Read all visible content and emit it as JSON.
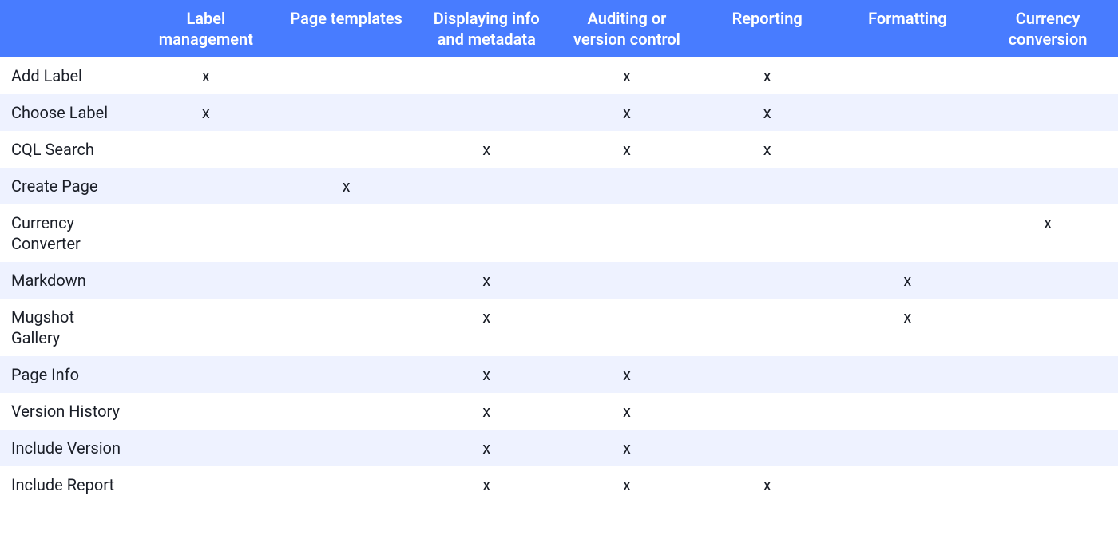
{
  "mark": "x",
  "columns": [
    "",
    "Label management",
    "Page templates",
    "Displaying info and metadata",
    "Auditing or version control",
    "Reporting",
    "Formatting",
    "Currency conversion"
  ],
  "rows": [
    {
      "label": "Add Label",
      "marks": [
        true,
        false,
        false,
        true,
        true,
        false,
        false
      ]
    },
    {
      "label": "Choose Label",
      "marks": [
        true,
        false,
        false,
        true,
        true,
        false,
        false
      ]
    },
    {
      "label": "CQL Search",
      "marks": [
        false,
        false,
        true,
        true,
        true,
        false,
        false
      ]
    },
    {
      "label": "Create Page",
      "marks": [
        false,
        true,
        false,
        false,
        false,
        false,
        false
      ]
    },
    {
      "label": "Currency Converter",
      "marks": [
        false,
        false,
        false,
        false,
        false,
        false,
        true
      ]
    },
    {
      "label": "Markdown",
      "marks": [
        false,
        false,
        true,
        false,
        false,
        true,
        false
      ]
    },
    {
      "label": "Mugshot Gallery",
      "marks": [
        false,
        false,
        true,
        false,
        false,
        true,
        false
      ]
    },
    {
      "label": "Page Info",
      "marks": [
        false,
        false,
        true,
        true,
        false,
        false,
        false
      ]
    },
    {
      "label": "Version History",
      "marks": [
        false,
        false,
        true,
        true,
        false,
        false,
        false
      ]
    },
    {
      "label": "Include Version",
      "marks": [
        false,
        false,
        true,
        true,
        false,
        false,
        false
      ]
    },
    {
      "label": "Include Report",
      "marks": [
        false,
        false,
        true,
        true,
        true,
        false,
        false
      ]
    }
  ]
}
